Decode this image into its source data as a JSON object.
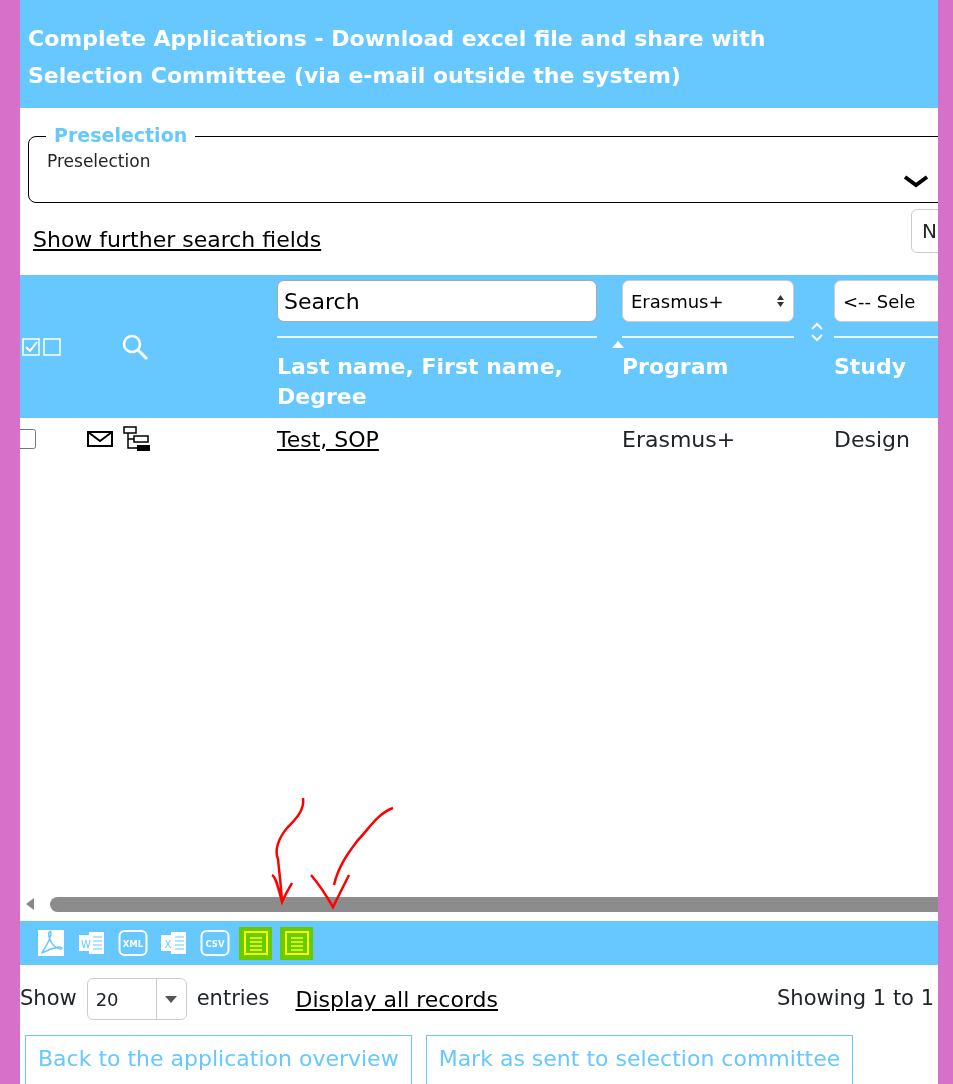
{
  "header": {
    "title": "Complete Applications - Download excel file and share with Selection Committee (via e-mail outside the system)"
  },
  "preselection": {
    "legend": "Preselection",
    "value": "Preselection"
  },
  "further_search_link": "Show further search fields",
  "length_select_partial": "N",
  "table": {
    "filters": {
      "search": "Search",
      "program": "Erasmus+",
      "study": "<-- Sele"
    },
    "columns": [
      {
        "label": "Last name, First name, Degree",
        "sorted": true
      },
      {
        "label": "Program",
        "sorted": false
      },
      {
        "label": "Study"
      }
    ],
    "rows": [
      {
        "checked": false,
        "name": "Test, SOP",
        "program": "Erasmus+",
        "study": "Design"
      }
    ]
  },
  "exports": [
    {
      "kind": "pdf",
      "highlighted": false
    },
    {
      "kind": "word",
      "label": "W",
      "highlighted": false
    },
    {
      "kind": "xml",
      "label": "XML",
      "highlighted": false
    },
    {
      "kind": "excel",
      "label": "X",
      "highlighted": false
    },
    {
      "kind": "csv",
      "label": "CSV",
      "highlighted": false
    },
    {
      "kind": "text",
      "highlighted": true
    },
    {
      "kind": "text",
      "highlighted": true
    }
  ],
  "footer": {
    "show_label": "Show",
    "page_size": "20",
    "entries_label": "entries",
    "display_all": "Display all records",
    "info": "Showing 1 to 1"
  },
  "buttons": [
    "Back to the application overview",
    "Mark as sent to selection committee"
  ]
}
